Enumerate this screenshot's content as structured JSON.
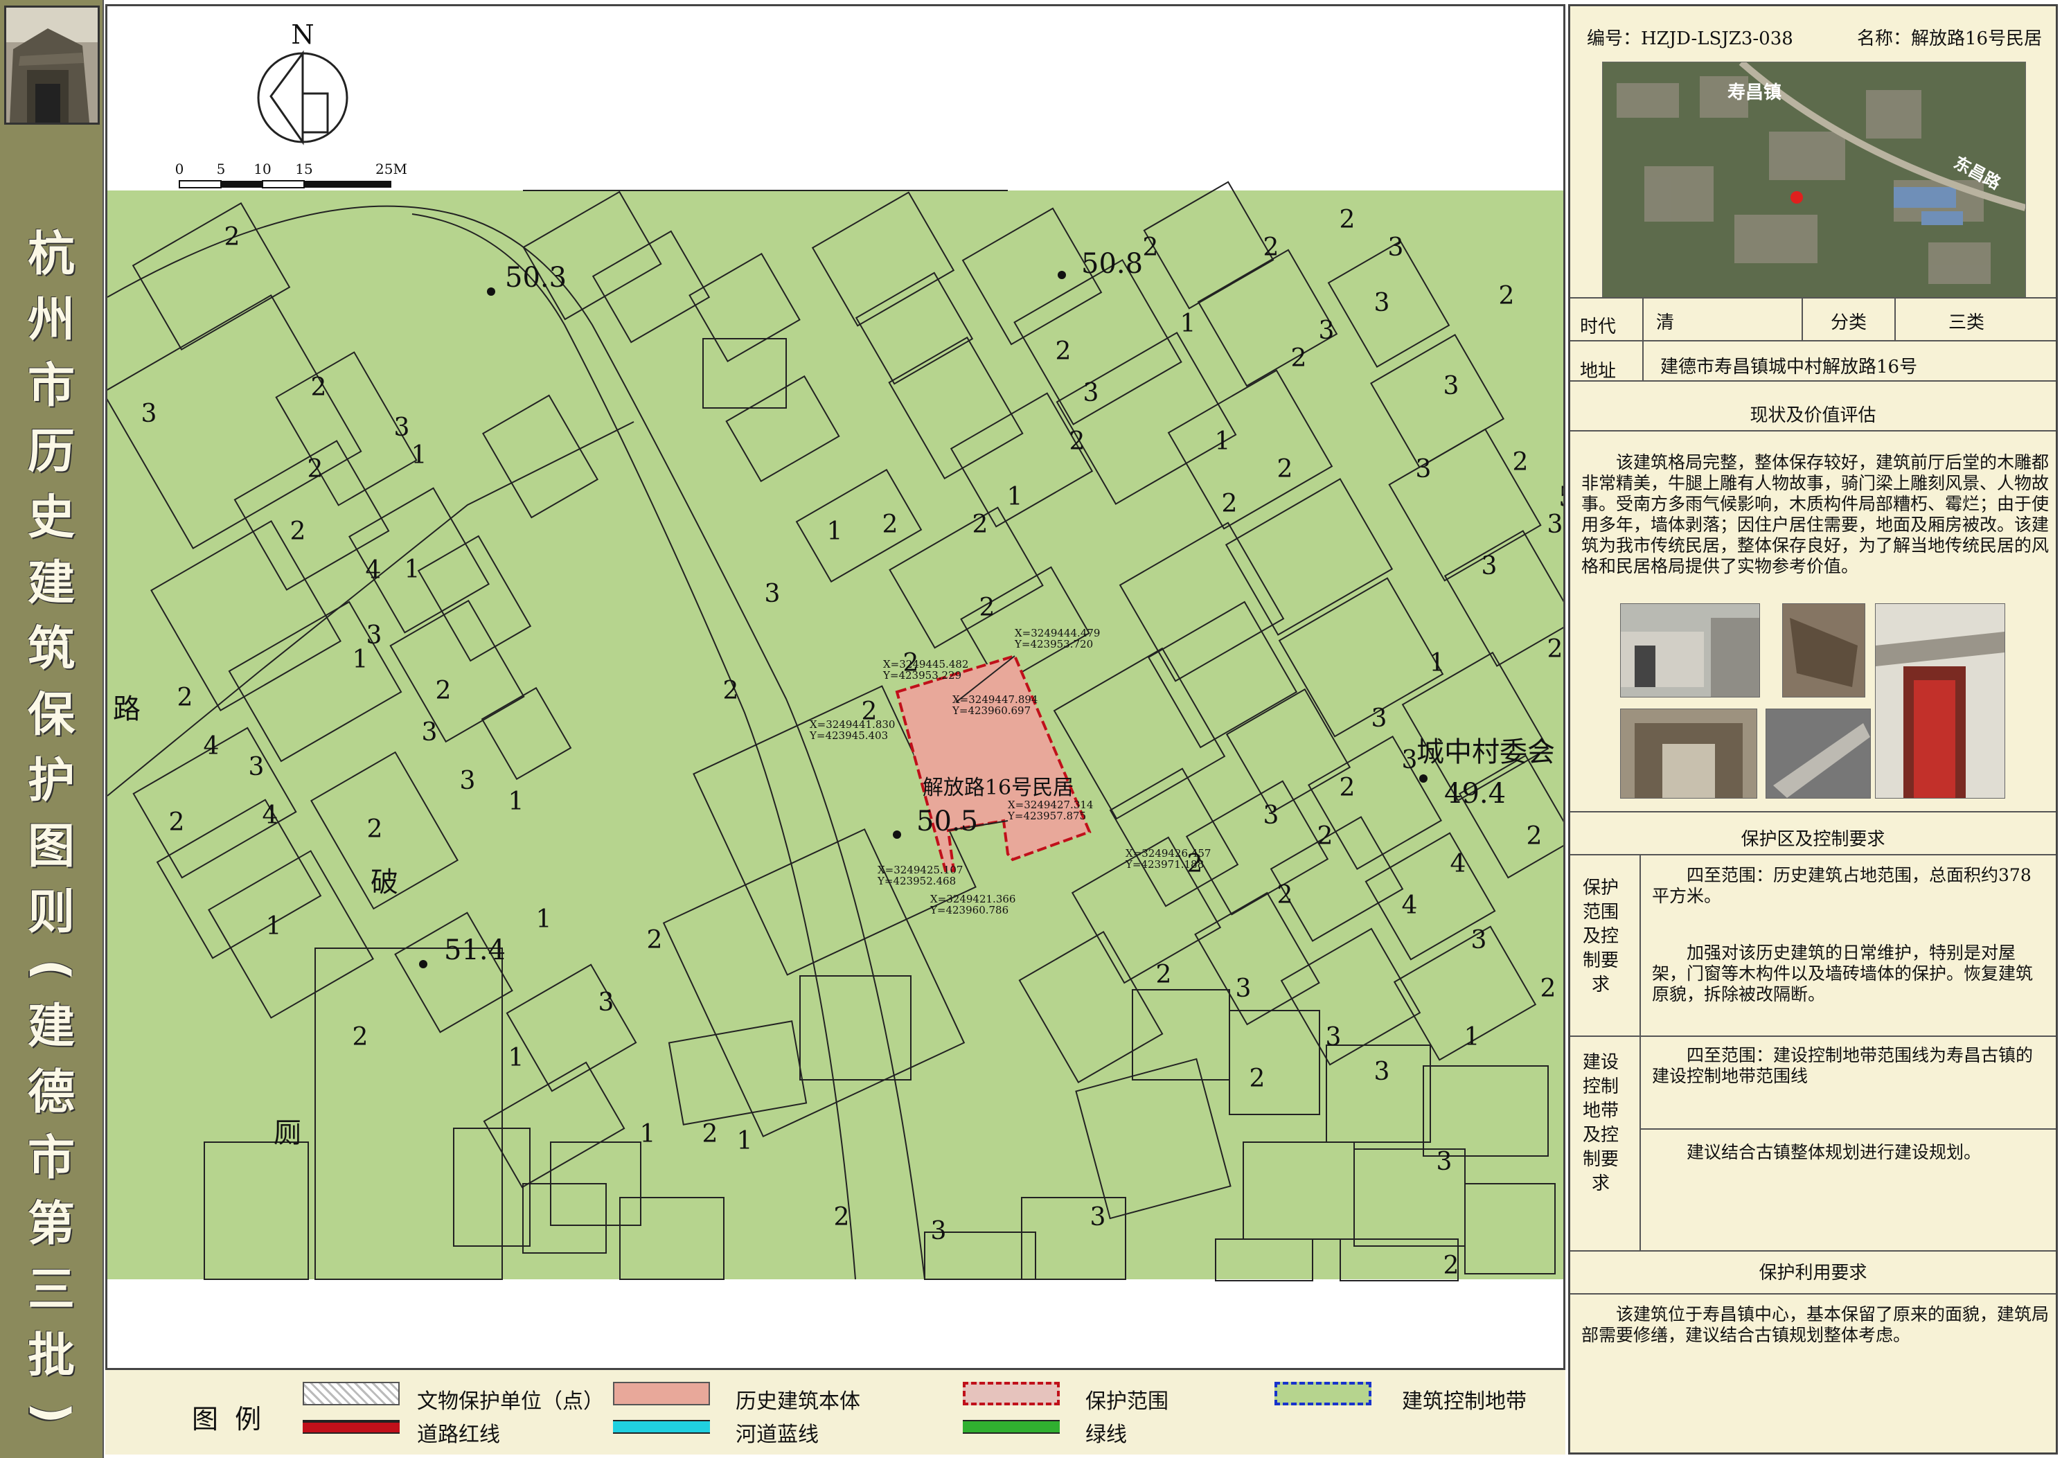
{
  "sidebar": {
    "title_chars": [
      "杭",
      "州",
      "市",
      "历",
      "史",
      "建",
      "筑",
      "保",
      "护",
      "图",
      "则",
      "(",
      "建",
      "德",
      "市",
      "第",
      "三",
      "批",
      ")"
    ]
  },
  "map": {
    "north_label": "N",
    "scale": {
      "ticks": [
        "0",
        "5",
        "10",
        "15",
        "25M"
      ]
    },
    "building_name": "解放路16号民居",
    "place_label": "城中村委会",
    "elevations": [
      "50.3",
      "50.8",
      "50.5",
      "51.4",
      "49.4",
      "50."
    ],
    "floor_labels": [
      "1",
      "2",
      "3",
      "4"
    ],
    "text_labels": [
      "路",
      "破",
      "厕"
    ],
    "coordinates": [
      {
        "x": "X=3249445.482",
        "y": "Y=423953.229"
      },
      {
        "x": "X=3249444.479",
        "y": "Y=423953.720"
      },
      {
        "x": "X=3249447.894",
        "y": "Y=423960.697"
      },
      {
        "x": "X=3249441.830",
        "y": "Y=423945.403"
      },
      {
        "x": "X=3249427.314",
        "y": "Y=423957.875"
      },
      {
        "x": "X=3249426.457",
        "y": "Y=423971.188"
      },
      {
        "x": "X=3249425.107",
        "y": "Y=423952.468"
      },
      {
        "x": "X=3249421.366",
        "y": "Y=423960.786"
      }
    ]
  },
  "legend": {
    "title": "图  例",
    "items": [
      {
        "label": "文物保护单位（点）",
        "style": "hatch"
      },
      {
        "label": "历史建筑本体",
        "style": "fill",
        "color": "#e8a89a"
      },
      {
        "label": "保护范围",
        "style": "dashed",
        "color": "#c0101a"
      },
      {
        "label": "建筑控制地带",
        "style": "dashed-fill",
        "color": "#1833cc",
        "fill": "#b6d48e"
      },
      {
        "label": "道路红线",
        "style": "line",
        "color": "#c0101a"
      },
      {
        "label": "河道蓝线",
        "style": "line",
        "color": "#20d0e0"
      },
      {
        "label": "绿线",
        "style": "line",
        "color": "#30b030"
      }
    ]
  },
  "panel": {
    "code_label": "编号：HZJD-LSJZ3-038",
    "name_label": "名称：解放路16号民居",
    "aerial": {
      "town_label": "寿昌镇",
      "road_label": "东昌路"
    },
    "era_key": "时代",
    "era_value": "清",
    "category_key": "分类",
    "category_value": "三类",
    "address_key": "地址",
    "address_value": "建德市寿昌镇城中村解放路16号",
    "assessment_title": "现状及价值评估",
    "assessment_text": "该建筑格局完整，整体保存较好，建筑前厅后堂的木雕都非常精美，牛腿上雕有人物故事，骑门梁上雕刻风景、人物故事。受南方多雨气候影响，木质构件局部糟朽、霉烂；由于使用多年，墙体剥落；因住户居住需要，地面及厢房被改。该建筑为我市传统民居，整体保存良好，为了解当地传统民居的风格和民居格局提供了实物参考价值。",
    "control_title": "保护区及控制要求",
    "protect_key": "保护范围及控制要求",
    "protect_text1": "四至范围：历史建筑占地范围，总面积约378平方米。",
    "protect_text2": "加强对该历史建筑的日常维护，特别是对屋架，门窗等木构件以及墙砖墙体的保护。恢复建筑原貌，拆除被改隔断。",
    "construct_key": "建设控制地带及控制要求",
    "construct_text1": "四至范围：建设控制地带范围线为寿昌古镇的建设控制地带范围线",
    "construct_text2": "建议结合古镇整体规划进行建设规划。",
    "use_title": "保护利用要求",
    "use_text": "该建筑位于寿昌镇中心，基本保留了原来的面貌，建筑局部需要修缮，建议结合古镇规划整体考虑。"
  },
  "colors": {
    "green": "#b6d48e",
    "heritage": "#e8a89a",
    "red": "#c0101a",
    "panel_bg": "#f7f2d6"
  }
}
